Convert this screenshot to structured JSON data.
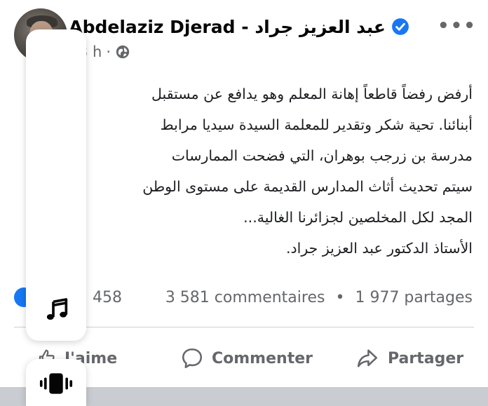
{
  "post": {
    "author": "Abdelaziz Djerad - عبد العزيز جراد",
    "time": "3 h",
    "dot": "·",
    "more_label": "•••",
    "body_lines": [
      "أرفض رفضاً قاطعاً إهانة المعلم وهو يدافع عن مستقبل",
      "أبنائنا. تحية شكر وتقدير للمعلمة السيدة سيديا مرابط",
      "مدرسة بن زرجب بوهران، التي فضحت الممارسات",
      "سيتم تحديث أثاث المدارس القديمة على مستوى الوطن",
      "المجد لكل المخلصين لجزائرنا الغالية...",
      "الأستاذ الدكتور عبد العزيز جراد."
    ],
    "stats": {
      "reactions_count": "458",
      "comments": "3 581 commentaires",
      "separator": "•",
      "shares": "1 977 partages"
    },
    "actions": {
      "like": "J'aime",
      "comment": "Commenter",
      "share": "Partager"
    },
    "colors": {
      "verified": "#1877f2",
      "secondary_text": "#65676b"
    }
  },
  "overlay": {
    "music_icon": "music-note-icon",
    "vibrate_icon": "vibrate-icon"
  }
}
